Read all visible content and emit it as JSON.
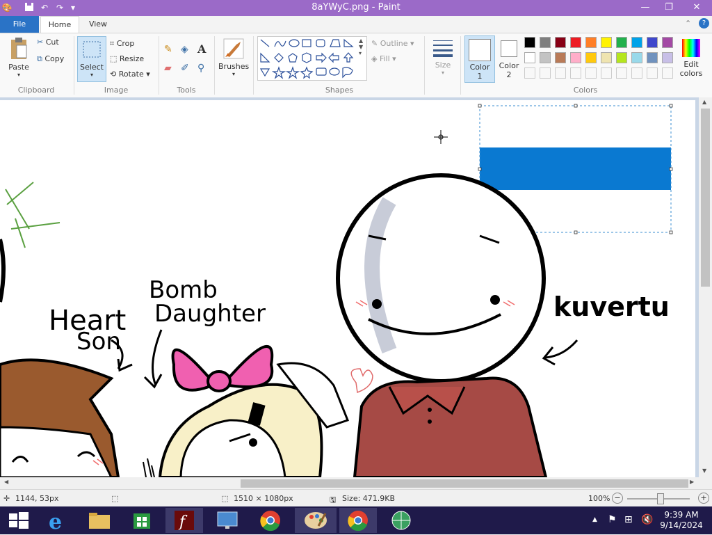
{
  "window": {
    "title": "8aYWyC.png - Paint"
  },
  "menu": {
    "file": "File",
    "home": "Home",
    "view": "View"
  },
  "clipboard": {
    "paste": "Paste",
    "cut": "Cut",
    "copy": "Copy",
    "label": "Clipboard"
  },
  "image": {
    "select": "Select",
    "crop": "Crop",
    "resize": "Resize",
    "rotate": "Rotate",
    "label": "Image"
  },
  "tools": {
    "label": "Tools"
  },
  "brushes": {
    "label": "Brushes"
  },
  "shapes": {
    "outline": "Outline",
    "fill": "Fill",
    "label": "Shapes"
  },
  "size": {
    "label": "Size"
  },
  "colors": {
    "color1": "Color 1",
    "color1_a": "Color",
    "color1_b": "1",
    "color2_a": "Color",
    "color2_b": "2",
    "edit_a": "Edit",
    "edit_b": "colors",
    "label": "Colors",
    "row1": [
      "#000000",
      "#7f7f7f",
      "#880015",
      "#ed1c24",
      "#ff7f27",
      "#fff200",
      "#22b14c",
      "#00a2e8",
      "#3f48cc",
      "#a349a4"
    ],
    "row2": [
      "#ffffff",
      "#c3c3c3",
      "#b97a57",
      "#ffaec9",
      "#ffc90e",
      "#efe4b0",
      "#b5e61d",
      "#99d9ea",
      "#7092be",
      "#c8bfe7"
    ]
  },
  "artwork": {
    "text1": "Heart",
    "text2": "Son",
    "text3": "Bomb",
    "text4": "Daughter",
    "text5": "kuvertu"
  },
  "status": {
    "cursor": "1144, 53px",
    "dimensions": "1510 × 1080px",
    "size": "Size: 471.9KB",
    "zoom": "100%"
  },
  "taskbar": {
    "time": "9:39 AM",
    "date": "9/14/2024"
  }
}
